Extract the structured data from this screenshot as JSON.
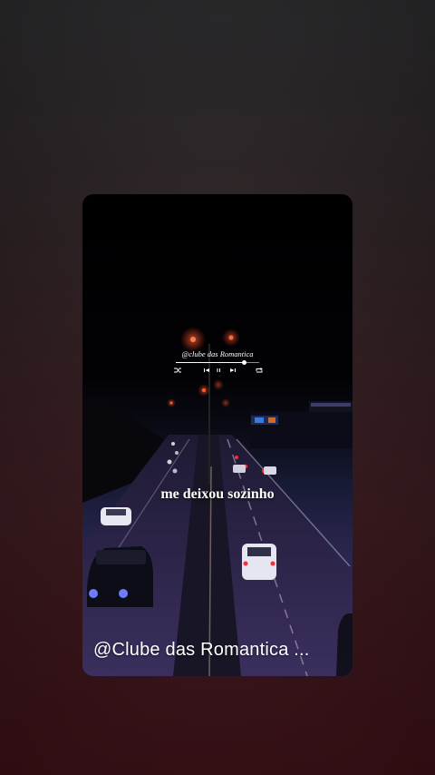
{
  "video": {
    "lyric": "me deixou sozinho",
    "watermark": "@Clube das Romantica ..."
  },
  "player": {
    "title": "@clube das Romantica",
    "progress": 0.82,
    "controls": [
      "shuffle-icon",
      "previous-icon",
      "pause-icon",
      "next-icon",
      "repeat-icon"
    ]
  },
  "colors": {
    "background_top": "#2a2a2c",
    "background_bottom": "#3d1117",
    "text": "#ffffff",
    "tail_light": "#ff2a3a",
    "street_light": "#ff5a2a",
    "headlight_blue": "#6e7bff"
  }
}
